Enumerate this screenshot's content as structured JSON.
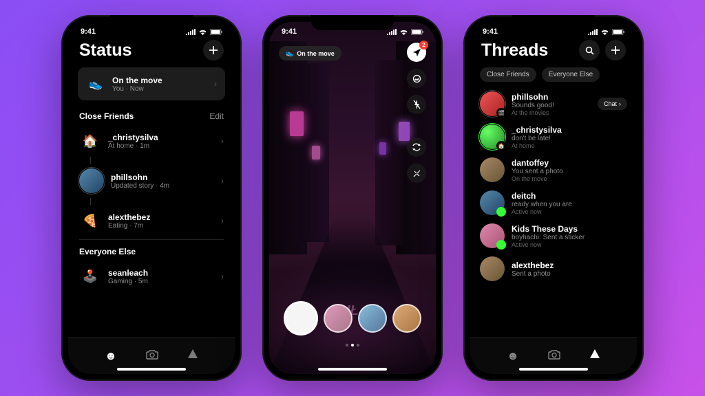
{
  "status_bar": {
    "time": "9:41"
  },
  "phone1": {
    "title": "Status",
    "self_status": {
      "label": "On the move",
      "sub": "You · Now"
    },
    "sections": {
      "close": {
        "header": "Close Friends",
        "action": "Edit"
      },
      "everyone": {
        "header": "Everyone Else"
      }
    },
    "friends_close": [
      {
        "emoji": "🏠",
        "name": "_christysilva",
        "sub": "At home · 1m"
      },
      {
        "emoji": "",
        "name": "phillsohn",
        "sub": "Updated story · 4m"
      },
      {
        "emoji": "🍕",
        "name": "alexthebez",
        "sub": "Eating · 7m"
      }
    ],
    "friends_everyone": [
      {
        "emoji": "🕹️",
        "name": "seanleach",
        "sub": "Gaming · 5m"
      }
    ]
  },
  "phone2": {
    "pill_label": "On the move",
    "notification_count": "2",
    "watermark": "IŁ"
  },
  "phone3": {
    "title": "Threads",
    "tabs": {
      "close": "Close Friends",
      "everyone": "Everyone Else"
    },
    "chat_label": "Chat",
    "threads": [
      {
        "name": "phillsohn",
        "msg": "Sounds good!",
        "meta": "At the movies"
      },
      {
        "name": "_christysilva",
        "msg": "don't be late!",
        "meta": "At home"
      },
      {
        "name": "dantoffey",
        "msg": "You sent a photo",
        "meta": "On the move"
      },
      {
        "name": "deitch",
        "msg": "ready when you are",
        "meta": "Active now"
      },
      {
        "name": "Kids These Days",
        "msg": "boyhachi: Sent a sticker",
        "meta": "Active now"
      },
      {
        "name": "alexthebez",
        "msg": "Sent a photo",
        "meta": ""
      }
    ]
  }
}
